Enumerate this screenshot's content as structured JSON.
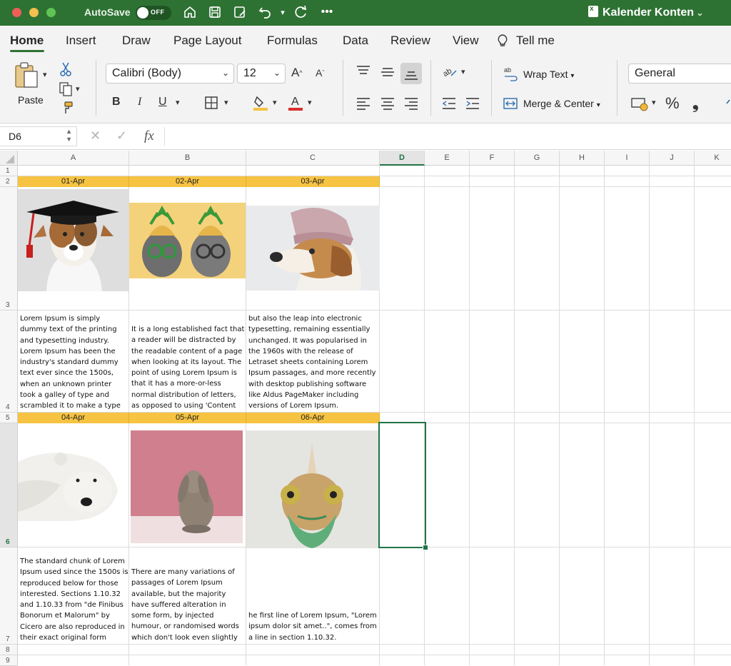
{
  "window": {
    "autosave_label": "AutoSave",
    "autosave_state": "OFF",
    "doc_title": "Kalender Konten"
  },
  "tabs": [
    "Home",
    "Insert",
    "Draw",
    "Page Layout",
    "Formulas",
    "Data",
    "Review",
    "View",
    "Tell me"
  ],
  "ribbon": {
    "paste_label": "Paste",
    "font_name": "Calibri (Body)",
    "font_size": "12",
    "wrap_text_label": "Wrap Text",
    "merge_center_label": "Merge & Center",
    "number_format": "General",
    "bold": "B",
    "italic": "I",
    "underline": "U"
  },
  "formula_bar": {
    "cell_ref": "D6",
    "fx_label": "fx",
    "value": ""
  },
  "grid": {
    "columns": [
      "A",
      "B",
      "C",
      "D",
      "E",
      "F",
      "G",
      "H",
      "I",
      "J",
      "K"
    ],
    "selected_column": "D",
    "rows": [
      "1",
      "2",
      "3",
      "4",
      "5",
      "6",
      "7",
      "8",
      "9"
    ],
    "dates_row1": [
      "01-Apr",
      "02-Apr",
      "03-Apr"
    ],
    "dates_row2": [
      "04-Apr",
      "05-Apr",
      "06-Apr"
    ],
    "texts_row1": [
      "Lorem Ipsum is simply dummy text of the printing and typesetting industry. Lorem Ipsum has been the industry's standard dummy text ever since the 1500s, when an unknown printer took a galley of type and scrambled it to make a type specimen book.",
      "It is a long established fact that a reader will be distracted by the readable content of a page when looking at its layout. The point of using Lorem Ipsum is that it has a more-or-less normal distribution of letters, as opposed to using 'Content here, content here",
      "but also the leap into electronic typesetting, remaining essentially unchanged. It was popularised in the 1960s with the release of Letraset sheets containing Lorem Ipsum passages, and more recently with desktop publishing software like Aldus PageMaker including versions of Lorem Ipsum."
    ],
    "texts_row2": [
      "The standard chunk of Lorem Ipsum used since the 1500s is reproduced below for those interested. Sections 1.10.32 and 1.10.33 from \"de Finibus Bonorum et Malorum\" by Cicero are also reproduced in their exact original form",
      "There are many variations of passages of Lorem Ipsum available, but the majority have suffered alteration in some form, by injected humour, or randomised words which don't look even slightly believable.",
      "he first line of Lorem Ipsum, \"Lorem ipsum dolor sit amet..\", comes from a line in section 1.10.32."
    ]
  },
  "colors": {
    "title_bar": "#2e7233",
    "accent": "#217346",
    "date_header": "#f6c342"
  }
}
